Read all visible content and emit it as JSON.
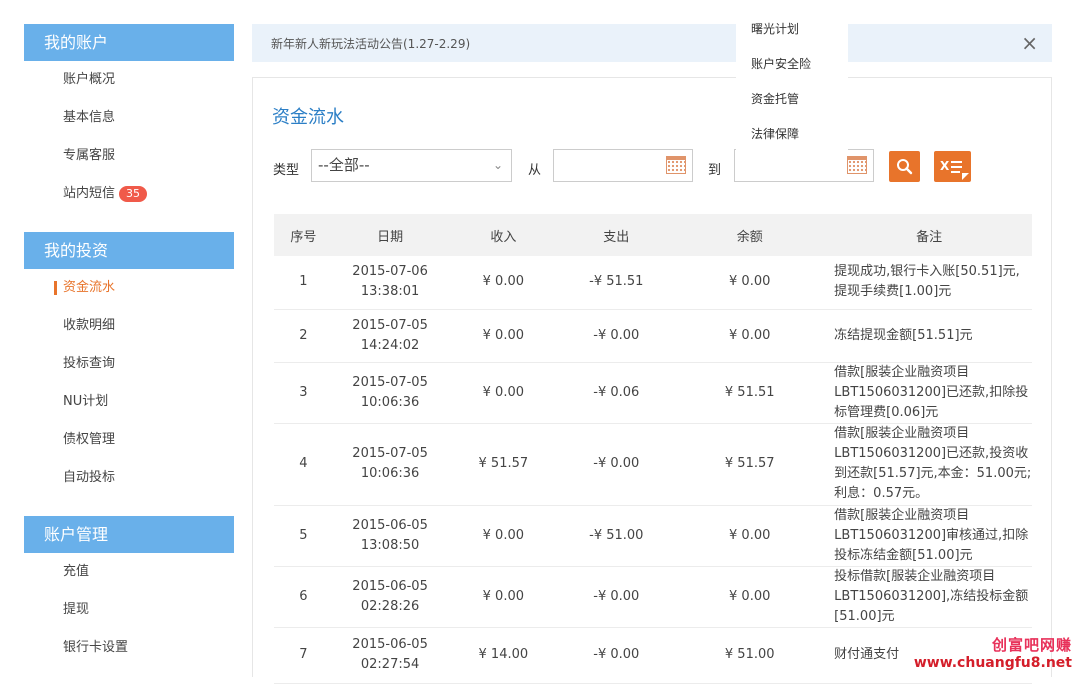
{
  "sidebar": {
    "groups": [
      {
        "header": "我的账户",
        "items": [
          {
            "label": "账户概况"
          },
          {
            "label": "基本信息"
          },
          {
            "label": "专属客服"
          },
          {
            "label": "站内短信",
            "badge": "35"
          }
        ]
      },
      {
        "header": "我的投资",
        "items": [
          {
            "label": "资金流水",
            "active": true
          },
          {
            "label": "收款明细"
          },
          {
            "label": "投标查询"
          },
          {
            "label": "NU计划"
          },
          {
            "label": "债权管理"
          },
          {
            "label": "自动投标"
          }
        ]
      },
      {
        "header": "账户管理",
        "items": [
          {
            "label": "充值"
          },
          {
            "label": "提现"
          },
          {
            "label": "银行卡设置"
          }
        ]
      }
    ]
  },
  "notice": {
    "text": "新年新人新玩法活动公告(1.27-2.29)",
    "close": "×"
  },
  "dropdown": {
    "items": [
      "曙光计划",
      "账户安全险",
      "资金托管",
      "法律保障"
    ]
  },
  "main": {
    "title": "资金流水",
    "filter": {
      "type_label": "类型",
      "type_value": "--全部--",
      "from_label": "从",
      "to_label": "到"
    },
    "table": {
      "headers": [
        "序号",
        "日期",
        "收入",
        "支出",
        "余额",
        "备注"
      ],
      "rows": [
        {
          "seq": "1",
          "date": "2015-07-06",
          "time": "13:38:01",
          "income": "¥ 0.00",
          "expense": "-¥ 51.51",
          "balance": "¥ 0.00",
          "note": [
            "提现成功,银行卡入账[50.51]元,",
            "提现手续费[1.00]元"
          ]
        },
        {
          "seq": "2",
          "date": "2015-07-05",
          "time": "14:24:02",
          "income": "¥ 0.00",
          "expense": "-¥ 0.00",
          "balance": "¥ 0.00",
          "note": [
            "冻结提现金额[51.51]元"
          ]
        },
        {
          "seq": "3",
          "date": "2015-07-05",
          "time": "10:06:36",
          "income": "¥ 0.00",
          "expense": "-¥ 0.06",
          "balance": "¥ 51.51",
          "note": [
            "借款[服装企业融资项目",
            "LBT1506031200]已还款,扣除投",
            "标管理费[0.06]元"
          ]
        },
        {
          "seq": "4",
          "date": "2015-07-05",
          "time": "10:06:36",
          "income": "¥ 51.57",
          "expense": "-¥ 0.00",
          "balance": "¥ 51.57",
          "note": [
            "借款[服装企业融资项目",
            "LBT1506031200]已还款,投资收",
            "到还款[51.57]元,本金：51.00元;",
            "利息：0.57元。"
          ]
        },
        {
          "seq": "5",
          "date": "2015-06-05",
          "time": "13:08:50",
          "income": "¥ 0.00",
          "expense": "-¥ 51.00",
          "balance": "¥ 0.00",
          "note": [
            "借款[服装企业融资项目",
            "LBT1506031200]审核通过,扣除",
            "投标冻结金额[51.00]元"
          ]
        },
        {
          "seq": "6",
          "date": "2015-06-05",
          "time": "02:28:26",
          "income": "¥ 0.00",
          "expense": "-¥ 0.00",
          "balance": "¥ 0.00",
          "note": [
            "投标借款[服装企业融资项目",
            "LBT1506031200],冻结投标金额",
            "[51.00]元"
          ]
        },
        {
          "seq": "7",
          "date": "2015-06-05",
          "time": "02:27:54",
          "income": "¥ 14.00",
          "expense": "-¥ 0.00",
          "balance": "¥ 51.00",
          "note": [
            "财付通支付"
          ]
        }
      ]
    }
  },
  "watermark": {
    "line1": "创富吧网赚",
    "line2": "www.chuangfu8.net"
  },
  "colors": {
    "accent": "#e8742b",
    "sidebar_header": "#69b0ea",
    "title": "#2c7fc6",
    "income": "#6a9a2a",
    "expense": "#d03b2b"
  }
}
